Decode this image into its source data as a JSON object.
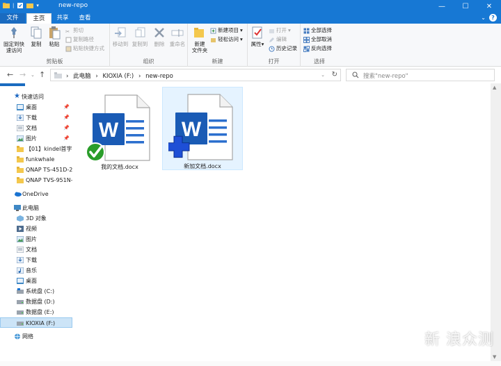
{
  "window": {
    "title": "new-repo",
    "controls": {
      "minimize": "—",
      "maximize": "☐",
      "close": "✕"
    }
  },
  "ribbon_tabs": [
    {
      "label": "文件"
    },
    {
      "label": "主页",
      "active": true
    },
    {
      "label": "共享"
    },
    {
      "label": "查看"
    }
  ],
  "ribbon": {
    "clipboard": {
      "label": "剪贴板",
      "pin": "固定到快\n速访问",
      "copy": "复制",
      "paste": "粘贴",
      "cut": "剪切",
      "copy_path": "复制路径",
      "paste_shortcut": "粘贴快捷方式"
    },
    "organize": {
      "label": "组织",
      "move_to": "移动到",
      "copy_to": "复制到",
      "delete": "删除",
      "rename": "重命名"
    },
    "new": {
      "label": "新建",
      "new_folder": "新建\n文件夹",
      "new_item": "新建项目",
      "easy_access": "轻松访问"
    },
    "open": {
      "label": "打开",
      "properties": "属性",
      "open": "打开",
      "edit": "编辑",
      "history": "历史记录"
    },
    "select": {
      "label": "选择",
      "select_all": "全部选择",
      "select_none": "全部取消",
      "invert": "反向选择"
    }
  },
  "address": {
    "crumbs": [
      "此电脑",
      "KIOXIA (F:)",
      "new-repo"
    ],
    "search_placeholder": "搜索\"new-repo\""
  },
  "nav_pane": {
    "quick_access": "快速访问",
    "quick_items": [
      "桌面",
      "下载",
      "文档",
      "图片",
      "【01】kindel首字8",
      "funkwhale",
      "QNAP TS-451D-2",
      "QNAP TVS-951N-"
    ],
    "onedrive": "OneDrive",
    "this_pc": "此电脑",
    "pc_items": [
      "3D 对象",
      "视频",
      "图片",
      "文档",
      "下载",
      "音乐",
      "桌面",
      "系统盘 (C:)",
      "数据盘 (D:)",
      "数据盘 (E:)",
      "KIOXIA (F:)"
    ],
    "network": "网络"
  },
  "files": [
    {
      "name": "我的文档.docx",
      "overlay": "check",
      "selected": false
    },
    {
      "name": "新加文档.docx",
      "overlay": "plus",
      "selected": true
    }
  ],
  "watermark": "新 浪众测",
  "colors": {
    "titlebar": "#1778d4",
    "word_blue": "#1a5bb5",
    "selection": "#cce4f7"
  }
}
